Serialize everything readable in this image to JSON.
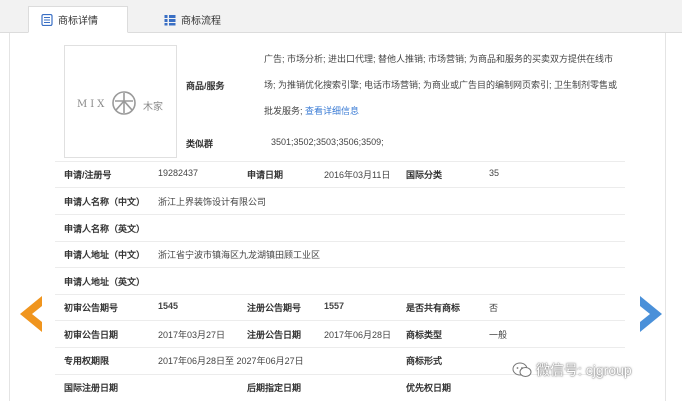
{
  "tabs": [
    {
      "label": "商标详情",
      "active": true,
      "icon": "doc-icon"
    },
    {
      "label": "商标流程",
      "active": false,
      "icon": "list-icon"
    }
  ],
  "logo": {
    "text_left": "MIX",
    "text_right": "木家"
  },
  "goods": {
    "label": "商品/服务",
    "text": "广告; 市场分析; 进出口代理; 替他人推销; 市场营销; 为商品和服务的买卖双方提供在线市场; 为推销优化搜索引擎; 电话市场营销; 为商业或广告目的编制网页索引; 卫生制剂零售或批发服务;",
    "link": "查看详细信息"
  },
  "similar_group": {
    "label": "类似群",
    "value": "3501;3502;3503;3506;3509;"
  },
  "fields": {
    "app_no_label": "申请/注册号",
    "app_no": "19282437",
    "app_date_label": "申请日期",
    "app_date": "2016年03月11日",
    "intl_class_label": "国际分类",
    "intl_class": "35",
    "applicant_cn_label": "申请人名称（中文）",
    "applicant_cn": "浙江上界装饰设计有限公司",
    "applicant_en_label": "申请人名称（英文）",
    "applicant_en": "",
    "address_cn_label": "申请人地址（中文）",
    "address_cn": "浙江省宁波市镇海区九龙湖镇田顾工业区",
    "address_en_label": "申请人地址（英文）",
    "address_en": "",
    "prelim_no_label": "初审公告期号",
    "prelim_no": "1545",
    "reg_no_label": "注册公告期号",
    "reg_no": "1557",
    "shared_label": "是否共有商标",
    "shared": "否",
    "prelim_date_label": "初审公告日期",
    "prelim_date": "2017年03月27日",
    "reg_date_label": "注册公告日期",
    "reg_date": "2017年06月28日",
    "type_label": "商标类型",
    "type": "一般",
    "period_label": "专用权期限",
    "period": "2017年06月28日至 2027年06月27日",
    "form_label": "商标形式",
    "form": "",
    "intl_reg_label": "国际注册日期",
    "intl_reg": "",
    "later_label": "后期指定日期",
    "later": "",
    "priority_label": "优先权日期",
    "priority": ""
  },
  "watermark": "微信号: cjgroup",
  "colors": {
    "arrow_left": "#f0951e",
    "arrow_right": "#4a90d9",
    "link": "#3a7bd5"
  }
}
